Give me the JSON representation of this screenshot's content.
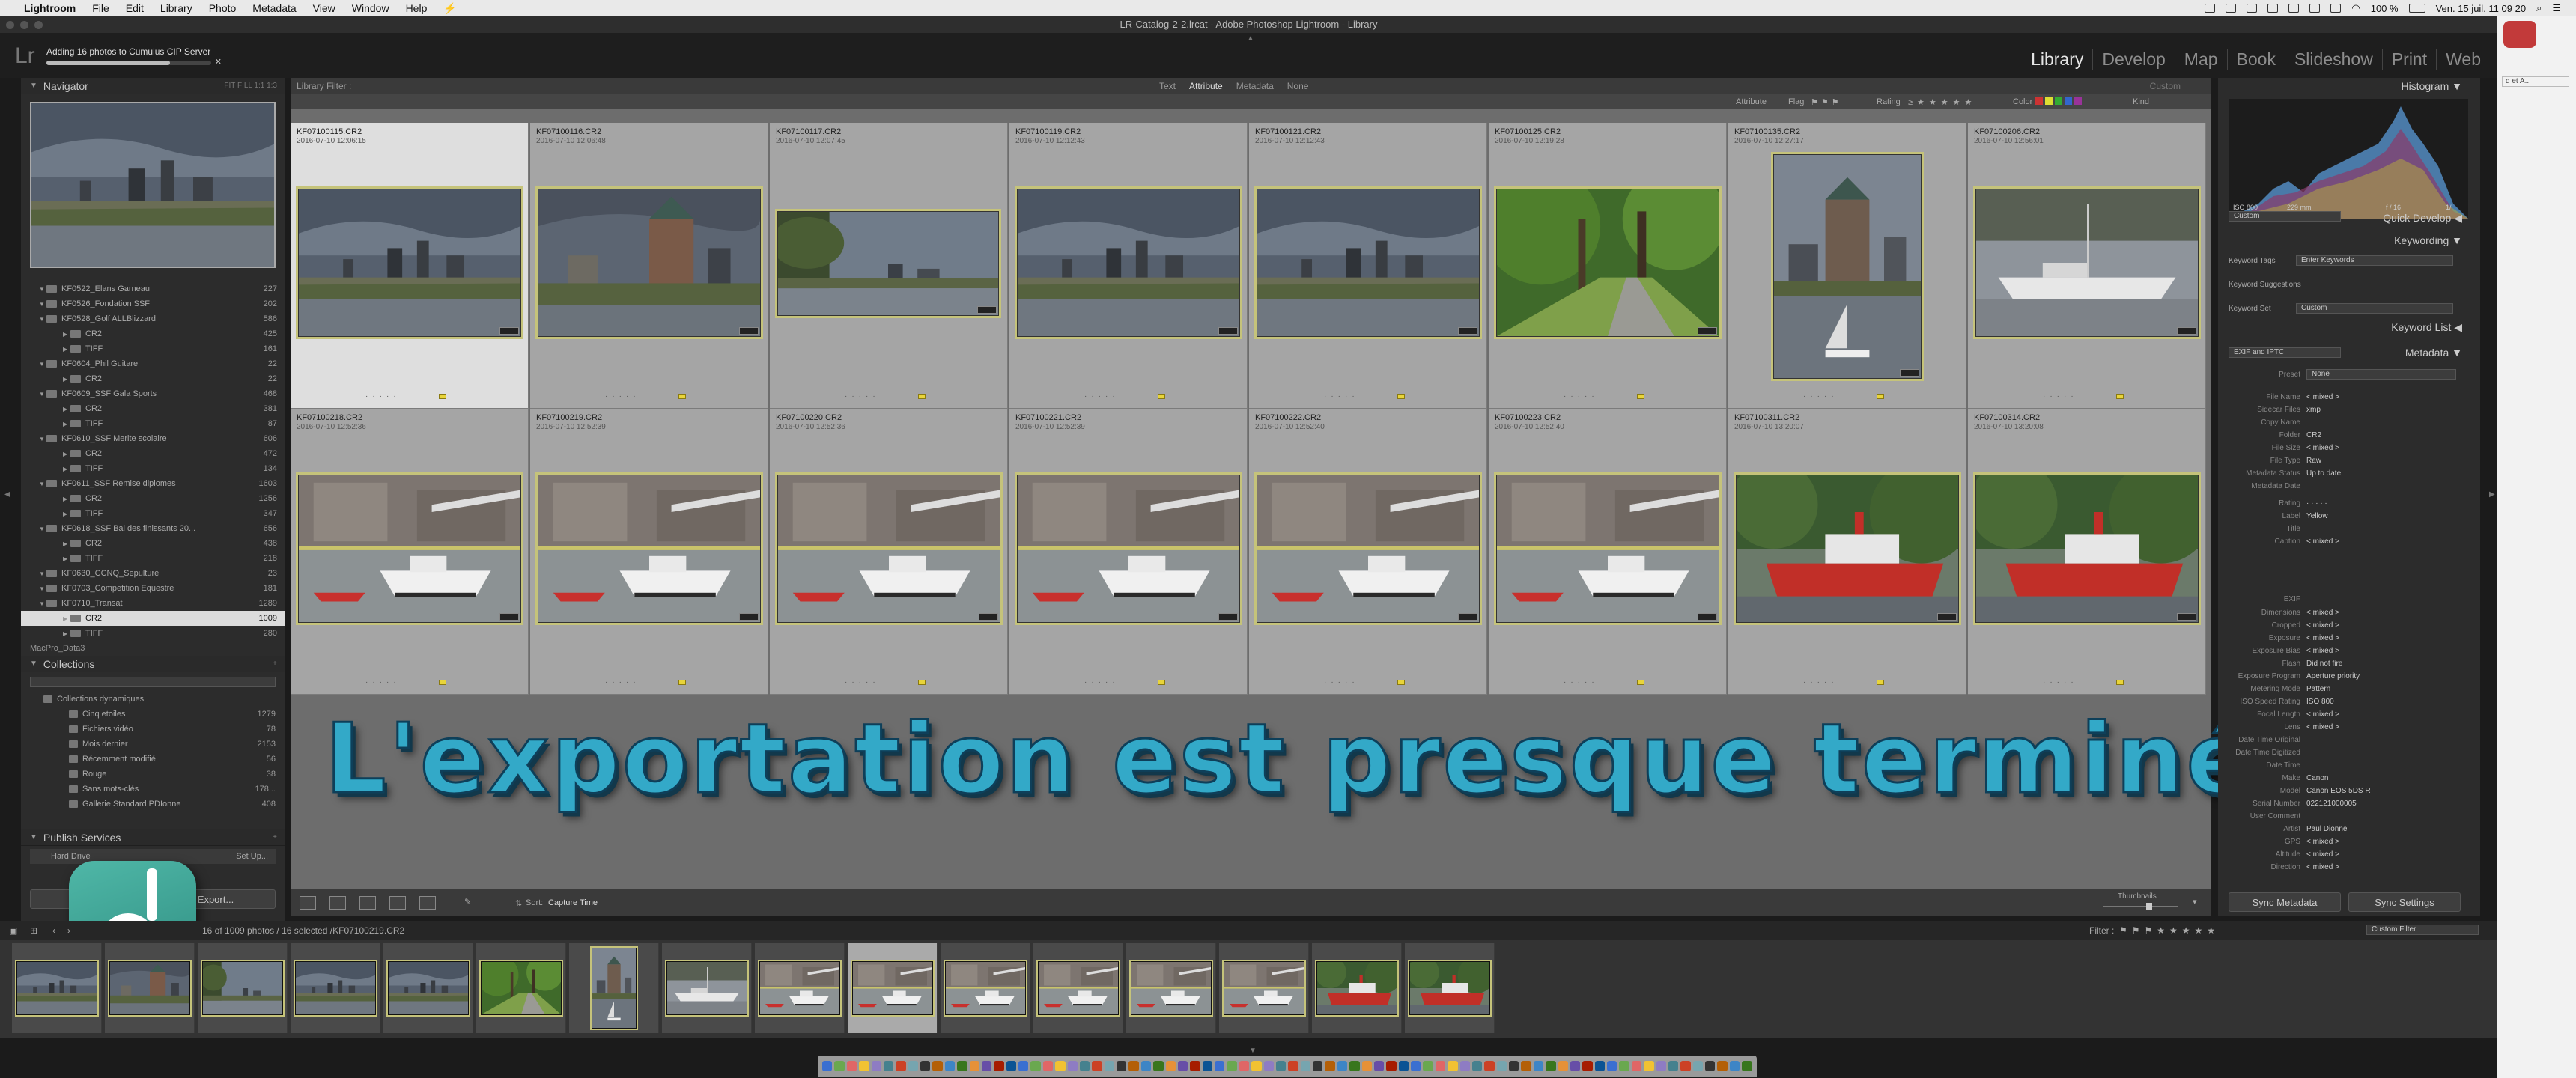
{
  "menubar": {
    "items": [
      "Lightroom",
      "File",
      "Edit",
      "Library",
      "Photo",
      "Metadata",
      "View",
      "Window",
      "Help"
    ],
    "right": {
      "battery": "100 %",
      "clock": "Ven. 15 juil.  11 09 20"
    }
  },
  "window": {
    "title": "LR-Catalog-2-2.lrcat - Adobe Photoshop Lightroom - Library"
  },
  "identity": {
    "logo": "Lr",
    "status": "Adding 16 photos to Cumulus CIP Server",
    "progress": 0.75
  },
  "modules": [
    "Library",
    "Develop",
    "Map",
    "Book",
    "Slideshow",
    "Print",
    "Web"
  ],
  "active_module": "Library",
  "left": {
    "navigator": {
      "label": "Navigator",
      "options": "FIT   FILL   1:1   1:3"
    },
    "folders": [
      {
        "name": "KF0522_Elans Garneau",
        "count": "227",
        "level": 1
      },
      {
        "name": "KF0526_Fondation SSF",
        "count": "202",
        "level": 1
      },
      {
        "name": "KF0528_Golf ALLBlizzard",
        "count": "586",
        "level": 1
      },
      {
        "name": "CR2",
        "count": "425",
        "level": 2
      },
      {
        "name": "TIFF",
        "count": "161",
        "level": 2
      },
      {
        "name": "KF0604_Phil Guitare",
        "count": "22",
        "level": 1
      },
      {
        "name": "CR2",
        "count": "22",
        "level": 2
      },
      {
        "name": "KF0609_SSF Gala Sports",
        "count": "468",
        "level": 1
      },
      {
        "name": "CR2",
        "count": "381",
        "level": 2
      },
      {
        "name": "TIFF",
        "count": "87",
        "level": 2
      },
      {
        "name": "KF0610_SSF Merite scolaire",
        "count": "606",
        "level": 1
      },
      {
        "name": "CR2",
        "count": "472",
        "level": 2
      },
      {
        "name": "TIFF",
        "count": "134",
        "level": 2
      },
      {
        "name": "KF0611_SSF Remise diplomes",
        "count": "1603",
        "level": 1
      },
      {
        "name": "CR2",
        "count": "1256",
        "level": 2
      },
      {
        "name": "TIFF",
        "count": "347",
        "level": 2
      },
      {
        "name": "KF0618_SSF Bal des finissants 20...",
        "count": "656",
        "level": 1
      },
      {
        "name": "CR2",
        "count": "438",
        "level": 2
      },
      {
        "name": "TIFF",
        "count": "218",
        "level": 2
      },
      {
        "name": "KF0630_CCNQ_Sepulture",
        "count": "23",
        "level": 1
      },
      {
        "name": "KF0703_Competition Equestre",
        "count": "181",
        "level": 1
      },
      {
        "name": "KF0710_Transat",
        "count": "1289",
        "level": 1
      },
      {
        "name": "CR2",
        "count": "1009",
        "level": 2,
        "selected": true
      },
      {
        "name": "TIFF",
        "count": "280",
        "level": 2
      }
    ],
    "drive": "MacPro_Data3",
    "collections_label": "Collections",
    "collections": [
      {
        "name": "Collections dynamiques",
        "count": "",
        "level": 1
      },
      {
        "name": "Cinq etoiles",
        "count": "1279",
        "level": 2
      },
      {
        "name": "Fichiers vidéo",
        "count": "78",
        "level": 2
      },
      {
        "name": "Mois dernier",
        "count": "2153",
        "level": 2
      },
      {
        "name": "Récemment modifié",
        "count": "56",
        "level": 2
      },
      {
        "name": "Rouge",
        "count": "38",
        "level": 2
      },
      {
        "name": "Sans mots-clés",
        "count": "178...",
        "level": 2
      },
      {
        "name": "Gallerie Standard PDIonne",
        "count": "408",
        "level": 2
      }
    ],
    "publish_label": "Publish Services",
    "publish": [
      {
        "name": "Hard Drive",
        "action": "Set Up..."
      }
    ],
    "buttons": {
      "import": "Import...",
      "export": "Export..."
    }
  },
  "filter": {
    "label": "Library Filter :",
    "tabs": [
      "Text",
      "Attribute",
      "Metadata",
      "None"
    ],
    "active": "Attribute",
    "preset": "Custom"
  },
  "attribute_bar": {
    "attribute": "Attribute",
    "flag": "Flag",
    "rating": "Rating",
    "color": "Color",
    "kind": "Kind"
  },
  "grid": [
    {
      "name": "KF07100115.CR2",
      "date": "2016-07-10 12:06:15",
      "scene": "city"
    },
    {
      "name": "KF07100116.CR2",
      "date": "2016-07-10 12:06:48",
      "scene": "city2"
    },
    {
      "name": "KF07100117.CR2",
      "date": "2016-07-10 12:07:45",
      "scene": "city3"
    },
    {
      "name": "KF07100119.CR2",
      "date": "2016-07-10 12:12:43",
      "scene": "city"
    },
    {
      "name": "KF07100121.CR2",
      "date": "2016-07-10 12:12:43",
      "scene": "city"
    },
    {
      "name": "KF07100125.CR2",
      "date": "2016-07-10 12:19:28",
      "scene": "path"
    },
    {
      "name": "KF07100135.CR2",
      "date": "2016-07-10 12:27:17",
      "scene": "portrait"
    },
    {
      "name": "KF07100206.CR2",
      "date": "2016-07-10 12:56:01",
      "scene": "sail"
    },
    {
      "name": "KF07100218.CR2",
      "date": "2016-07-10 12:52:36",
      "scene": "boat"
    },
    {
      "name": "KF07100219.CR2",
      "date": "2016-07-10 12:52:39",
      "scene": "boat"
    },
    {
      "name": "KF07100220.CR2",
      "date": "2016-07-10 12:52:36",
      "scene": "boat"
    },
    {
      "name": "KF07100221.CR2",
      "date": "2016-07-10 12:52:39",
      "scene": "boat"
    },
    {
      "name": "KF07100222.CR2",
      "date": "2016-07-10 12:52:40",
      "scene": "boat"
    },
    {
      "name": "KF07100223.CR2",
      "date": "2016-07-10 12:52:40",
      "scene": "boat"
    },
    {
      "name": "KF07100311.CR2",
      "date": "2016-07-10 13:20:07",
      "scene": "ship"
    },
    {
      "name": "KF07100314.CR2",
      "date": "2016-07-10 13:20:08",
      "scene": "ship"
    }
  ],
  "overlay_text": "L'exportation est presque terminée...",
  "toolbar": {
    "sort_label": "Sort:",
    "sort_value": "Capture Time",
    "thumbnails_label": "Thumbnails"
  },
  "right": {
    "histogram_label": "Histogram",
    "histo_info": {
      "iso": "ISO 800",
      "focal": "229 mm",
      "aperture": "f / 16",
      "shutter": "1/"
    },
    "quick_develop": {
      "label": "Quick Develop",
      "preset": "Custom"
    },
    "keywording": {
      "label": "Keywording",
      "tags_label": "Keyword Tags",
      "tags_value": "Enter Keywords",
      "suggestions": "Keyword Suggestions",
      "set_label": "Keyword Set",
      "set_value": "Custom"
    },
    "keyword_list": "Keyword List",
    "metadata": {
      "label": "Metadata",
      "view": "EXIF and IPTC",
      "preset_label": "Preset",
      "preset_value": "None",
      "rows_a": [
        {
          "k": "File Name",
          "v": "< mixed >"
        },
        {
          "k": "Sidecar Files",
          "v": "xmp"
        },
        {
          "k": "Copy Name",
          "v": ""
        },
        {
          "k": "Folder",
          "v": "CR2"
        },
        {
          "k": "File Size",
          "v": "< mixed >"
        },
        {
          "k": "File Type",
          "v": "Raw"
        },
        {
          "k": "Metadata Status",
          "v": "Up to date"
        },
        {
          "k": "Metadata Date",
          "v": ""
        }
      ],
      "rows_b": [
        {
          "k": "Rating",
          "v": "·  ·  ·  ·  ·"
        },
        {
          "k": "Label",
          "v": "Yellow"
        },
        {
          "k": "Title",
          "v": ""
        },
        {
          "k": "Caption",
          "v": "< mixed >"
        }
      ],
      "exif_label": "EXIF",
      "rows_c": [
        {
          "k": "Dimensions",
          "v": "< mixed >"
        },
        {
          "k": "Cropped",
          "v": "< mixed >"
        },
        {
          "k": "Exposure",
          "v": "< mixed >"
        },
        {
          "k": "Exposure Bias",
          "v": "< mixed >"
        },
        {
          "k": "Flash",
          "v": "Did not fire"
        },
        {
          "k": "Exposure Program",
          "v": "Aperture priority"
        },
        {
          "k": "Metering Mode",
          "v": "Pattern"
        },
        {
          "k": "ISO Speed Rating",
          "v": "ISO 800"
        },
        {
          "k": "Focal Length",
          "v": "< mixed >"
        },
        {
          "k": "Lens",
          "v": "< mixed >"
        },
        {
          "k": "Date Time Original",
          "v": ""
        },
        {
          "k": "Date Time Digitized",
          "v": ""
        },
        {
          "k": "Date Time",
          "v": ""
        },
        {
          "k": "Make",
          "v": "Canon"
        },
        {
          "k": "Model",
          "v": "Canon EOS 5DS R"
        },
        {
          "k": "Serial Number",
          "v": "022121000005"
        },
        {
          "k": "User Comment",
          "v": ""
        },
        {
          "k": "Artist",
          "v": "Paul Dionne"
        },
        {
          "k": "GPS",
          "v": "< mixed >"
        },
        {
          "k": "Altitude",
          "v": "< mixed >"
        },
        {
          "k": "Direction",
          "v": "< mixed >"
        }
      ]
    },
    "buttons": {
      "sync_metadata": "Sync Metadata",
      "sync_settings": "Sync Settings"
    }
  },
  "filmstrip_bar": {
    "count": "16 of 1009 photos / 16 selected /KF07100219.CR2",
    "filter_label": "Filter :",
    "filter_value": "Custom Filter"
  },
  "filmstrip": [
    "city",
    "city2",
    "city3",
    "city",
    "city",
    "path",
    "portrait",
    "sail",
    "boat",
    "boat",
    "boat",
    "boat",
    "boat",
    "boat",
    "ship",
    "ship"
  ],
  "colors": {
    "accent": "#c5c37a",
    "label": "#e8d43a",
    "overlay": "#33a9c8"
  }
}
